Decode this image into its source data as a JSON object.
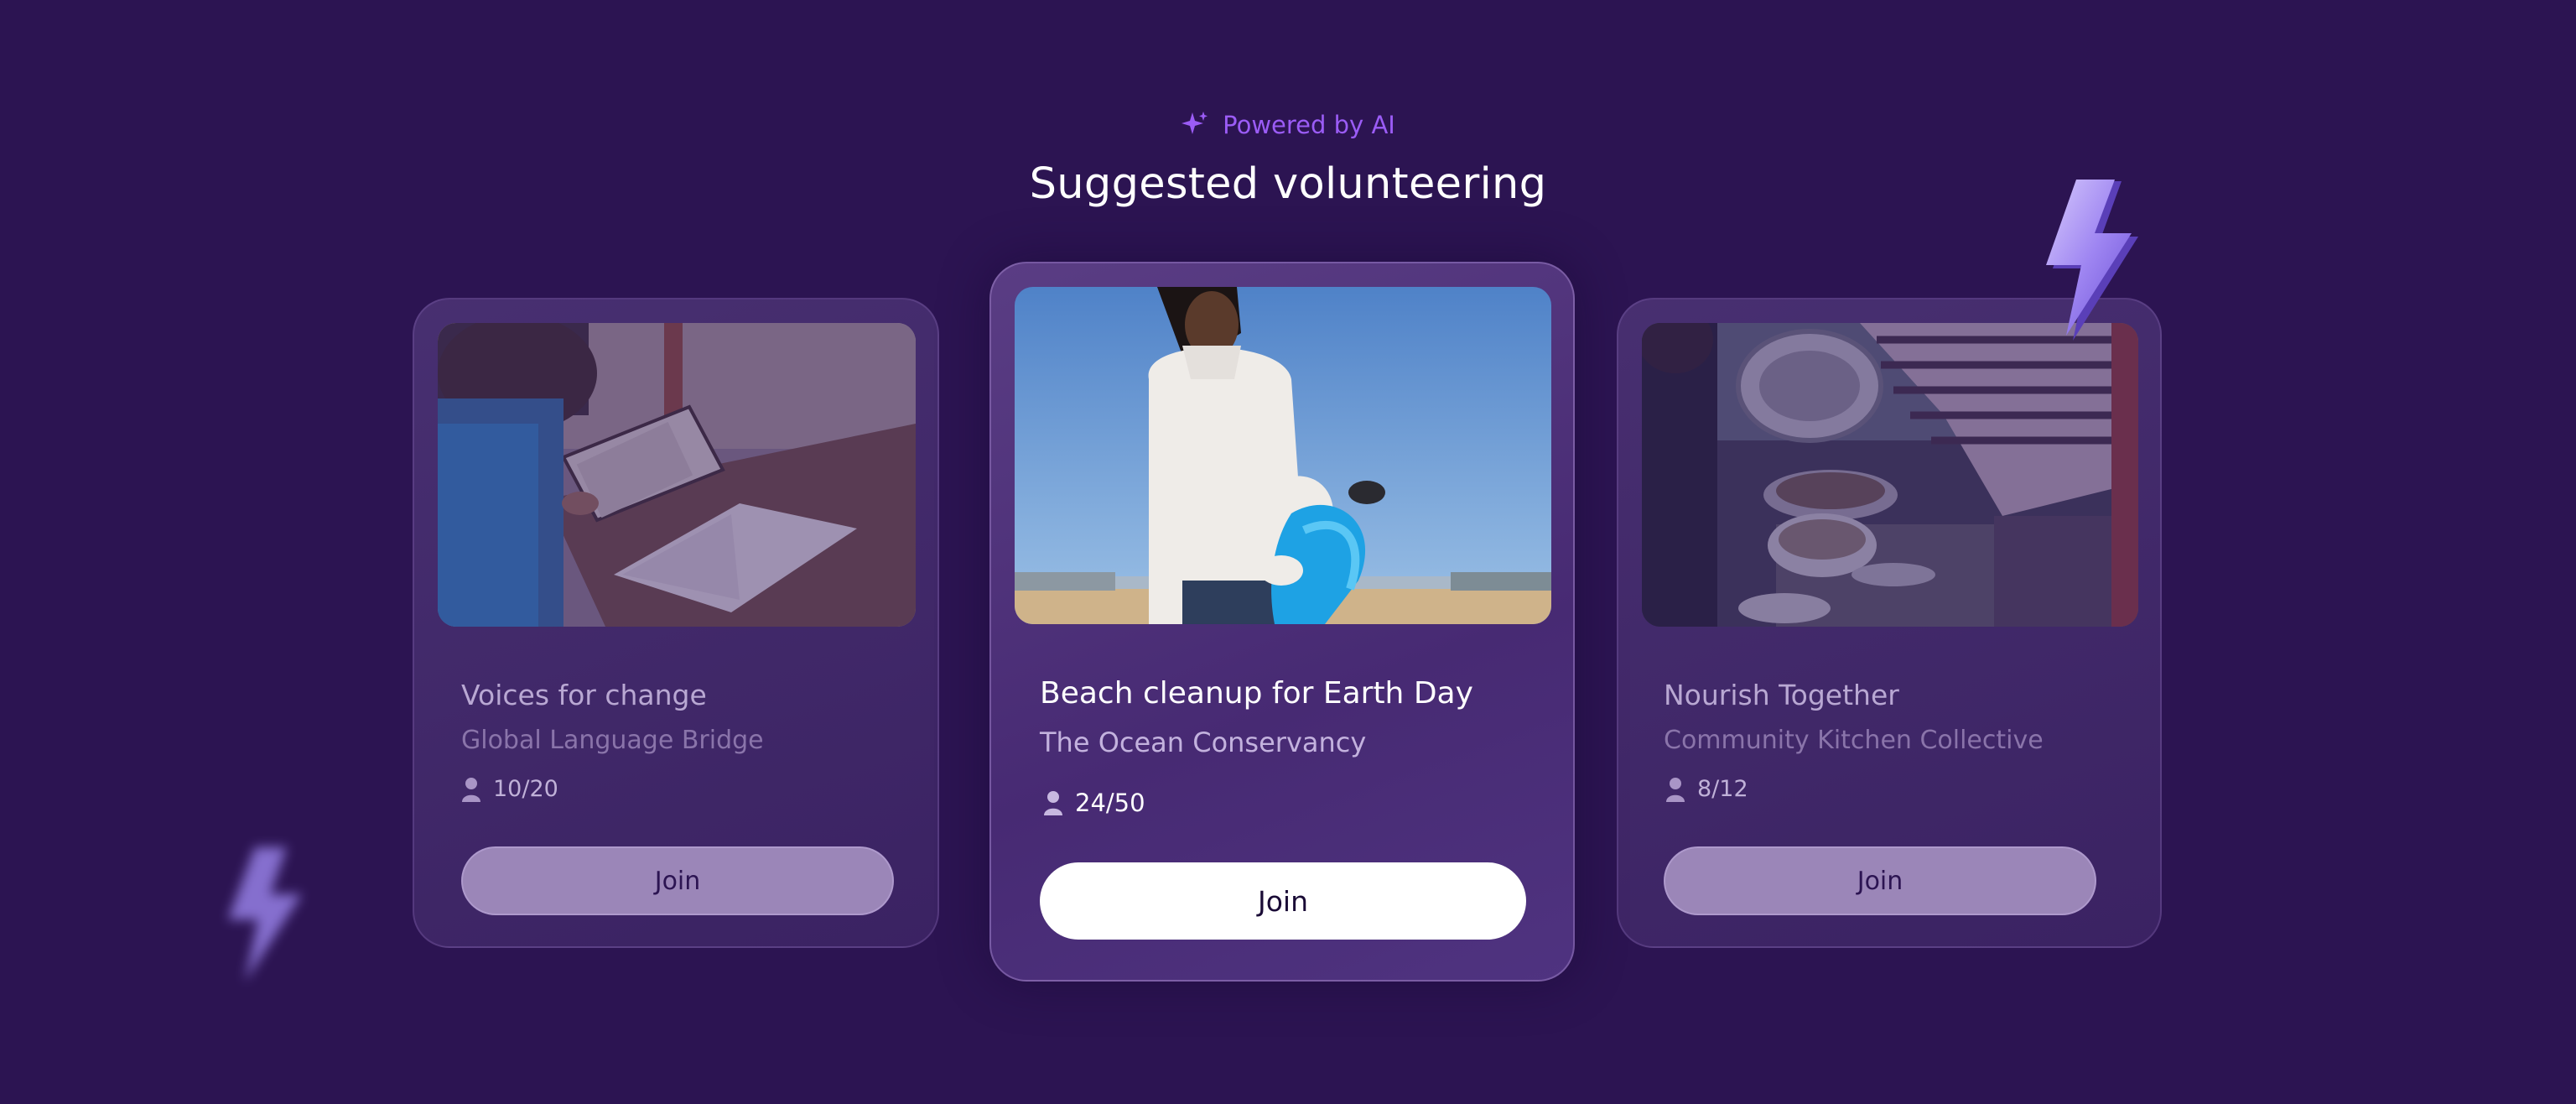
{
  "header": {
    "badge_icon": "sparkle-icon",
    "badge_text": "Powered by AI",
    "title": "Suggested volunteering"
  },
  "cards": [
    {
      "title": "Voices for change",
      "organization": "Global Language Bridge",
      "slots": "10/20",
      "join_label": "Join",
      "image": "child reading books at a table"
    },
    {
      "title": "Beach cleanup for Earth Day",
      "organization": "The Ocean Conservancy",
      "slots": "24/50",
      "join_label": "Join",
      "image": "woman in white hoodie holding blue trash bag on beach"
    },
    {
      "title": "Nourish Together",
      "organization": "Community Kitchen Collective",
      "slots": "8/12",
      "join_label": "Join",
      "image": "people serving food from pots"
    }
  ],
  "colors": {
    "background": "#2c1452",
    "accent": "#9b5cf6",
    "primary_button": "#ffffff",
    "muted_button": "#9b86b8"
  },
  "decorations": [
    "lightning-bolt-icon",
    "lightning-bolt-icon-blurred"
  ]
}
